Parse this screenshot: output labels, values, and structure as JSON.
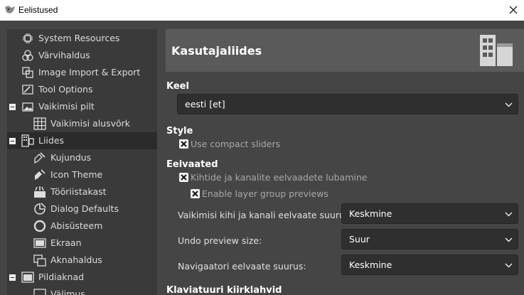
{
  "window": {
    "title": "Eelistused"
  },
  "sidebar": {
    "items": [
      {
        "label": "System Resources",
        "icon": "chip-icon"
      },
      {
        "label": "Värvihaldus",
        "icon": "color-circles-icon"
      },
      {
        "label": "Image Import & Export",
        "icon": "import-export-icon"
      },
      {
        "label": "Tool Options",
        "icon": "tool-options-icon"
      },
      {
        "label": "Vaikimisi pilt",
        "icon": "image-icon"
      },
      {
        "label": "Vaikimisi alusvõrk",
        "icon": "grid-icon"
      },
      {
        "label": "Liides",
        "icon": "interface-icon"
      },
      {
        "label": "Kujundus",
        "icon": "theme-icon"
      },
      {
        "label": "Icon Theme",
        "icon": "icon-theme-icon"
      },
      {
        "label": "Tööriistakast",
        "icon": "toolbox-icon"
      },
      {
        "label": "Dialog Defaults",
        "icon": "dialog-defaults-icon"
      },
      {
        "label": "Abisüsteem",
        "icon": "help-system-icon"
      },
      {
        "label": "Ekraan",
        "icon": "display-icon"
      },
      {
        "label": "Aknahaldus",
        "icon": "window-management-icon"
      },
      {
        "label": "Pildiaknad",
        "icon": "image-windows-icon"
      },
      {
        "label": "Välimus",
        "icon": "appearance-icon"
      }
    ]
  },
  "main": {
    "header_title": "Kasutajaliides",
    "language": {
      "section": "Keel",
      "value": "eesti [et]"
    },
    "style": {
      "section": "Style",
      "compact_sliders": "Use compact sliders"
    },
    "previews": {
      "section": "Eelvaated",
      "layer_channel_previews": "Kihtide ja kanalite eelvaadete lubamine",
      "layer_group_previews": "Enable layer group previews",
      "default_preview_size_label": "Vaikimisi kihi ja kanali eelvaate suurus:",
      "default_preview_size_value": "Keskmine",
      "undo_preview_size_label": "Undo preview size:",
      "undo_preview_size_value": "Suur",
      "navigator_preview_size_label": "Navigaatori eelvaate suurus:",
      "navigator_preview_size_value": "Keskmine"
    },
    "keyboard_section": "Klaviatuuri kiirklahvid"
  }
}
